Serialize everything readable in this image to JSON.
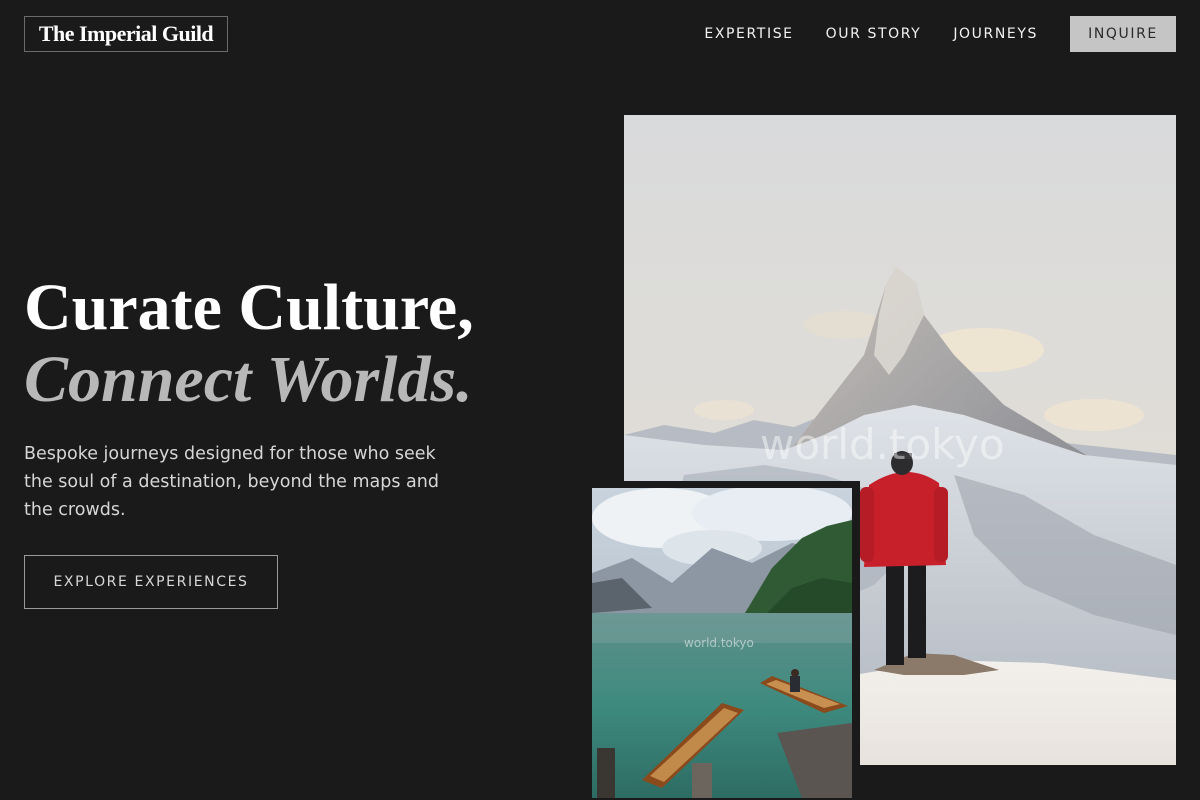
{
  "header": {
    "logo": "The Imperial Guild",
    "nav": [
      {
        "label": "EXPERTISE"
      },
      {
        "label": "OUR STORY"
      },
      {
        "label": "JOURNEYS"
      }
    ],
    "cta": "INQUIRE"
  },
  "hero": {
    "headline_line1": "Curate Culture,",
    "headline_line2": "Connect Worlds.",
    "subtext": "Bespoke journeys designed for those who seek the soul of a destination, beyond the maps and the crowds.",
    "button": "EXPLORE EXPERIENCES"
  },
  "images": {
    "main": {
      "subject": "hiker-on-snowy-mountain-peak",
      "watermark": "world.tokyo"
    },
    "secondary": {
      "subject": "rowboats-on-alpine-lake",
      "watermark": "world.tokyo"
    }
  },
  "colors": {
    "background": "#1a1a1a",
    "text": "#ffffff",
    "muted_text": "#b8b8b8",
    "inquire_bg": "#c5c5c5"
  }
}
